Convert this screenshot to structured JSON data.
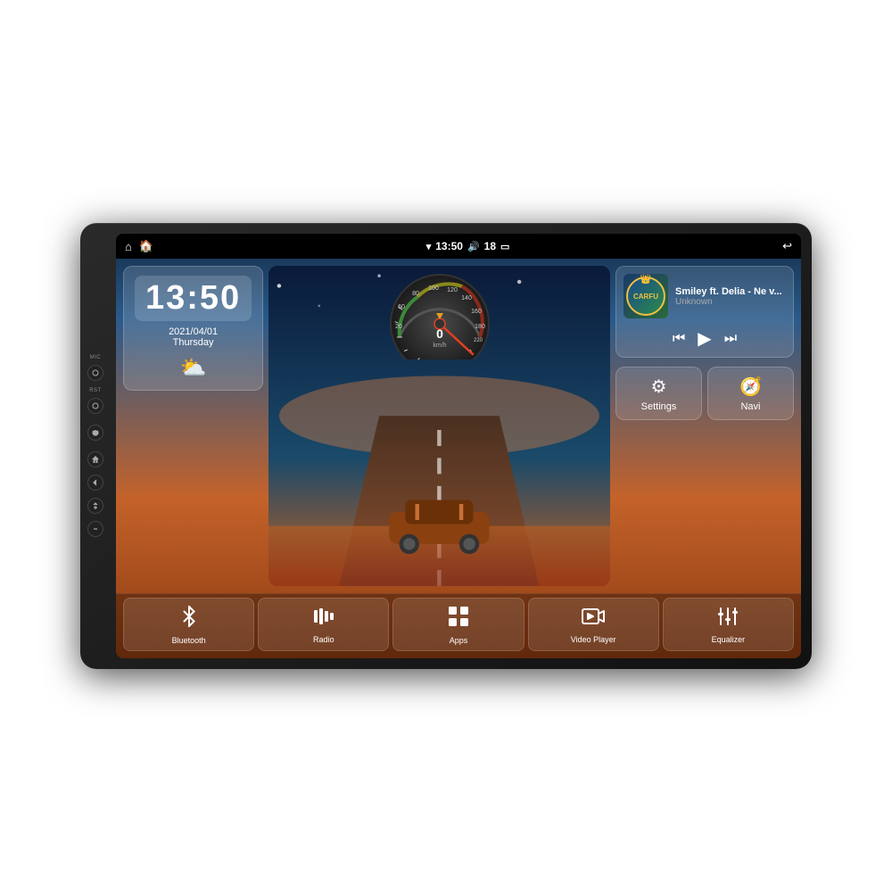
{
  "device": {
    "side_labels": [
      "MIC",
      "RST"
    ],
    "buttons": [
      "home",
      "back",
      "power",
      "home2",
      "vol_up",
      "vol_down"
    ]
  },
  "status_bar": {
    "home_icon": "⌂",
    "house_icon": "🏠",
    "time": "13:50",
    "signal_icon": "▾",
    "volume": "18",
    "battery_icon": "▭",
    "back_icon": "↩"
  },
  "clock": {
    "time": "13:50",
    "date": "2021/04/01",
    "day": "Thursday"
  },
  "speedometer": {
    "speed": "0",
    "unit": "km/h"
  },
  "music": {
    "title": "Smiley ft. Delia - Ne v...",
    "artist": "Unknown",
    "album_text": "CARFU"
  },
  "widgets": {
    "settings_label": "Settings",
    "navi_label": "Navi"
  },
  "apps": [
    {
      "id": "bluetooth",
      "label": "Bluetooth",
      "icon": "bluetooth"
    },
    {
      "id": "radio",
      "label": "Radio",
      "icon": "radio"
    },
    {
      "id": "apps",
      "label": "Apps",
      "icon": "apps"
    },
    {
      "id": "video_player",
      "label": "Video Player",
      "icon": "video"
    },
    {
      "id": "equalizer",
      "label": "Equalizer",
      "icon": "equalizer"
    }
  ]
}
